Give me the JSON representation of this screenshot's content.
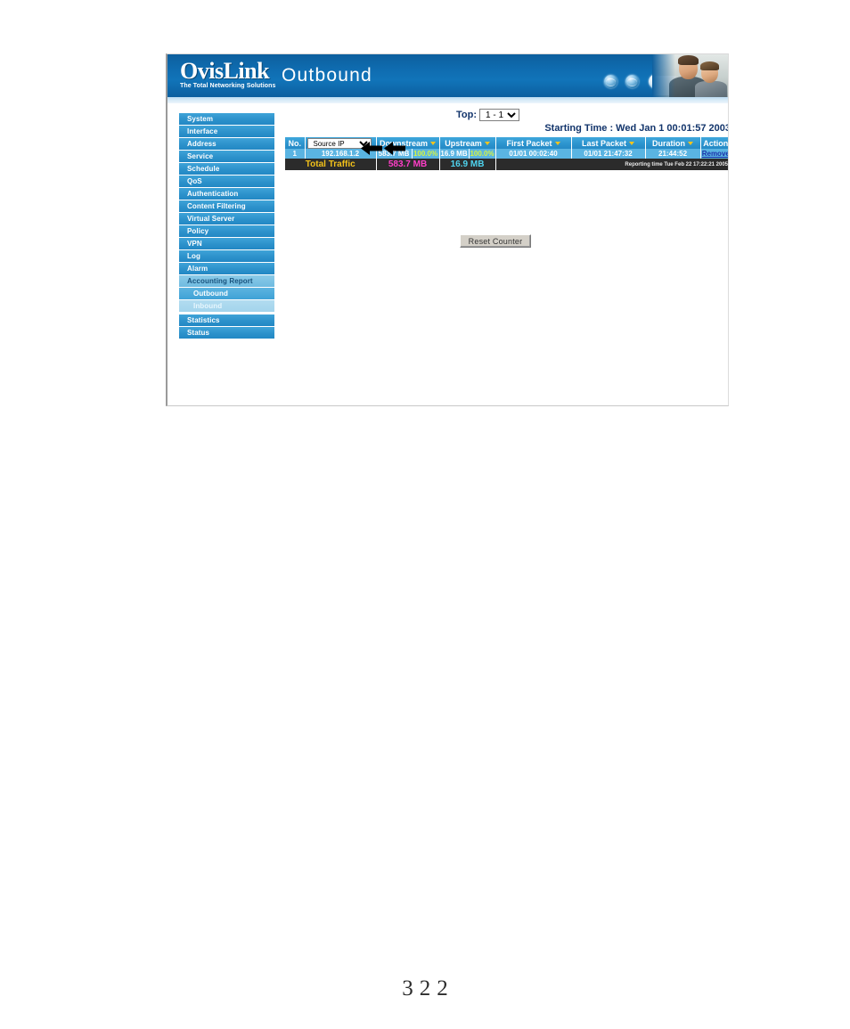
{
  "banner": {
    "logo_word": "OvisLink",
    "logo_tagline": "The Total Networking Solutions",
    "title": "Outbound",
    "icons": [
      "globe-icon",
      "globe-icon",
      "globe-icon",
      "globe-icon"
    ],
    "photo_alt": "man-and-boy-at-computer-photo",
    "bg_color": "#0f6cb0"
  },
  "sidebar": {
    "items": [
      {
        "label": "System",
        "state": "normal"
      },
      {
        "label": "Interface",
        "state": "normal"
      },
      {
        "label": "Address",
        "state": "normal"
      },
      {
        "label": "Service",
        "state": "normal"
      },
      {
        "label": "Schedule",
        "state": "normal"
      },
      {
        "label": "QoS",
        "state": "normal"
      },
      {
        "label": "Authentication",
        "state": "normal"
      },
      {
        "label": "Content Filtering",
        "state": "normal"
      },
      {
        "label": "Virtual Server",
        "state": "normal"
      },
      {
        "label": "Policy",
        "state": "normal"
      },
      {
        "label": "VPN",
        "state": "normal"
      },
      {
        "label": "Log",
        "state": "normal"
      },
      {
        "label": "Alarm",
        "state": "normal"
      },
      {
        "label": "Accounting Report",
        "state": "section-active"
      }
    ],
    "sub_items": [
      {
        "label": "Outbound",
        "state": "selected"
      },
      {
        "label": "Inbound",
        "state": "normal"
      }
    ],
    "tail_items": [
      {
        "label": "Statistics",
        "state": "normal"
      },
      {
        "label": "Status",
        "state": "normal"
      }
    ],
    "active_color": "#8ccbe8",
    "item_color": "#2e93cc"
  },
  "main": {
    "top_label": "Top:",
    "top_selected": "1 - 1",
    "top_options": [
      "1 - 1"
    ],
    "starting_time": "Starting Time : Wed Jan 1 00:01:57 2003",
    "reset_button": "Reset Counter",
    "source_ip_selected": "Source IP",
    "source_ip_options": [
      "Source IP"
    ]
  },
  "table": {
    "headers": [
      {
        "label": "No.",
        "sortable": false
      },
      {
        "label": "Source IP",
        "sortable": true,
        "is_select": true
      },
      {
        "label": "Downstream",
        "sortable": true
      },
      {
        "label": "Upstream",
        "sortable": true
      },
      {
        "label": "First Packet",
        "sortable": true
      },
      {
        "label": "Last Packet",
        "sortable": true
      },
      {
        "label": "Duration",
        "sortable": true
      },
      {
        "label": "Action",
        "sortable": false
      }
    ],
    "rows": [
      {
        "no": "1",
        "source_ip": "192.168.1.2",
        "downstream": "583.7 MB",
        "downstream_pct": "100.0%",
        "upstream": "16.9 MB",
        "upstream_pct": "100.0%",
        "first_packet": "01/01 00:02:40",
        "last_packet": "01/01 21:47:32",
        "duration": "21:44:52",
        "action": "Remove"
      }
    ],
    "total": {
      "label": "Total Traffic",
      "downstream": "583.7 MB",
      "upstream": "16.9 MB",
      "reporting_time": "Reporting time Tue Feb 22 17:22:21 2005"
    },
    "colors": {
      "header_bg": "#2d95cf",
      "row_bg": "#5ab4e2",
      "total_bg": "#2b2b2b",
      "total_label": "#f3c21a",
      "total_downstream": "#ff3ec8",
      "total_upstream": "#4fd4ef",
      "percent": "#d6f442",
      "link": "#1b2fa8"
    }
  },
  "annotations": {
    "arrows": [
      "left-arrow-icon",
      "left-arrow-icon"
    ]
  },
  "footer": {
    "page_number": "322"
  }
}
